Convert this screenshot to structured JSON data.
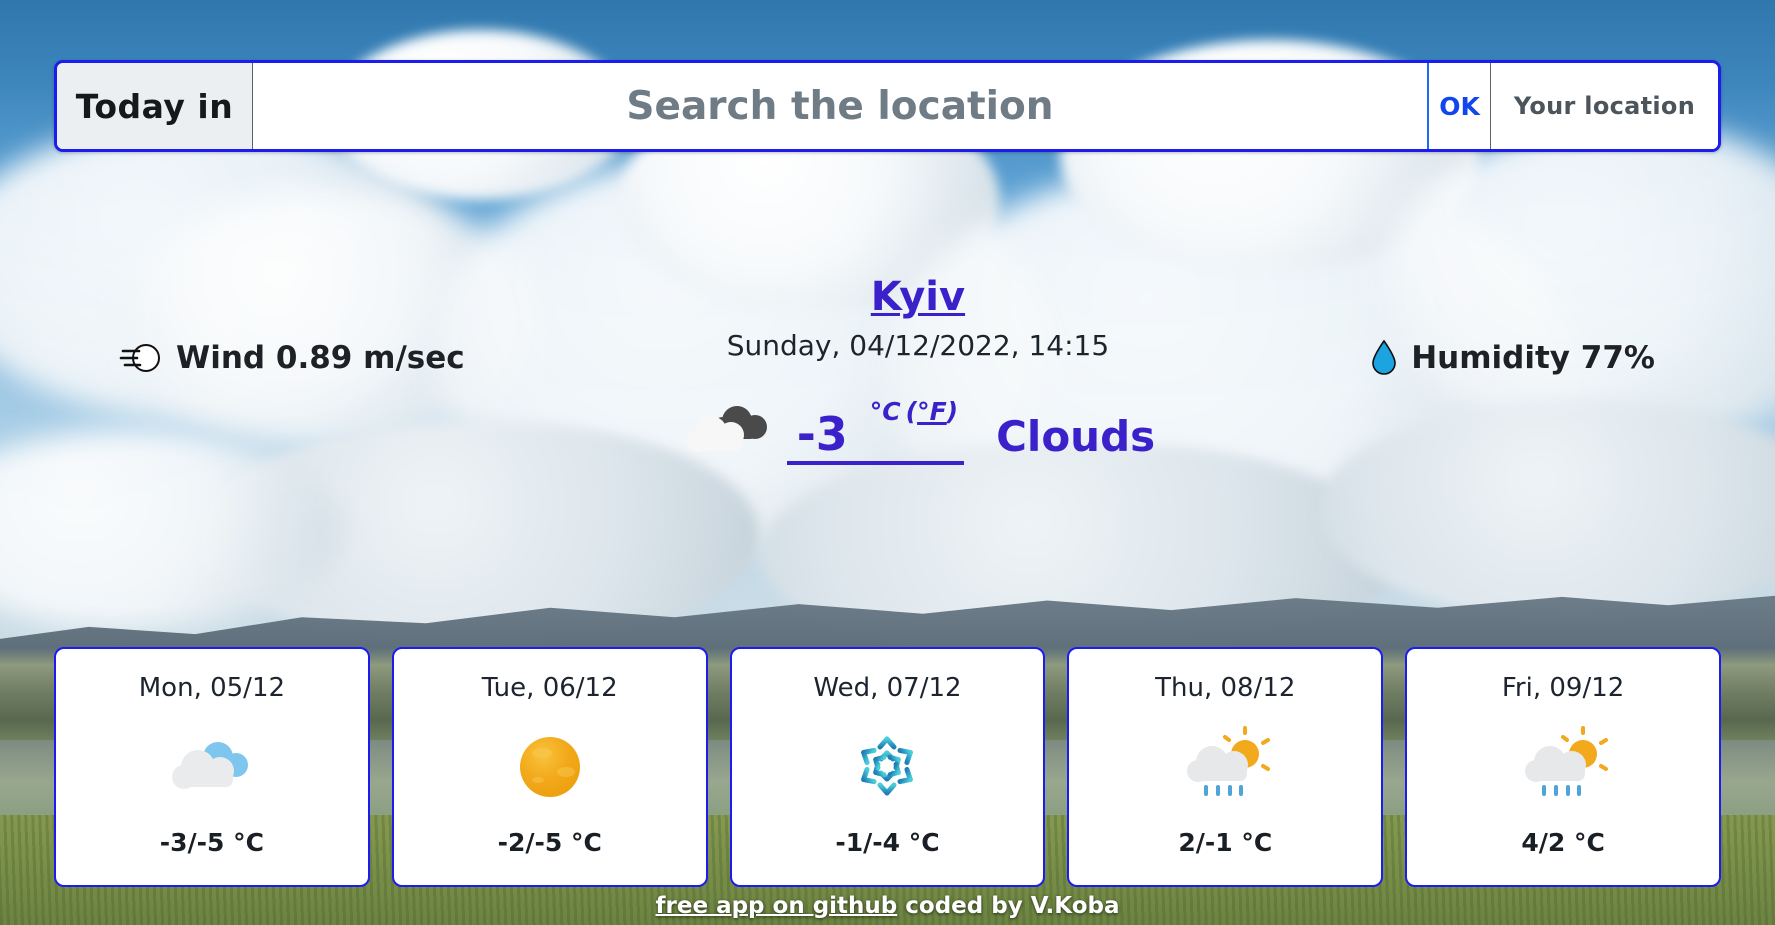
{
  "search": {
    "today_in_label": "Today in",
    "placeholder": "Search the location",
    "value": "",
    "ok_label": "OK",
    "your_location_label": "Your location"
  },
  "current": {
    "wind_icon": "wind-face-icon",
    "wind_text": "Wind 0.89 m/sec",
    "city": "Kyiv",
    "datetime": "Sunday, 04/12/2022, 14:15",
    "humidity_icon": "water-droplet-icon",
    "humidity_text": "Humidity 77%",
    "weather_icon": "clouds-icon",
    "temperature": "-3",
    "unit_celsius": "°C",
    "unit_fahrenheit_open": "(",
    "unit_fahrenheit": "°F",
    "unit_fahrenheit_close": ")",
    "condition": "Clouds"
  },
  "forecast": [
    {
      "day": "Mon, 05/12",
      "icon": "partly-cloudy-icon",
      "temp": "-3/-5 °C"
    },
    {
      "day": "Tue, 06/12",
      "icon": "sun-icon",
      "temp": "-2/-5 °C"
    },
    {
      "day": "Wed, 07/12",
      "icon": "snowflake-icon",
      "temp": "-1/-4 °C"
    },
    {
      "day": "Thu, 08/12",
      "icon": "sun-rain-icon",
      "temp": "2/-1 °C"
    },
    {
      "day": "Fri, 09/12",
      "icon": "sun-rain-icon",
      "temp": "4/2 °C"
    }
  ],
  "footer": {
    "link_text": "free app on github",
    "credit_text": " coded by V.Koba"
  },
  "colors": {
    "accent_border": "#1c1cf0",
    "link_purple": "#3b21c9",
    "ok_blue": "#1146ef",
    "droplet_blue": "#1ca4e0",
    "sun_orange": "#f2a91b",
    "snow_cyan": "#36bdd4"
  }
}
